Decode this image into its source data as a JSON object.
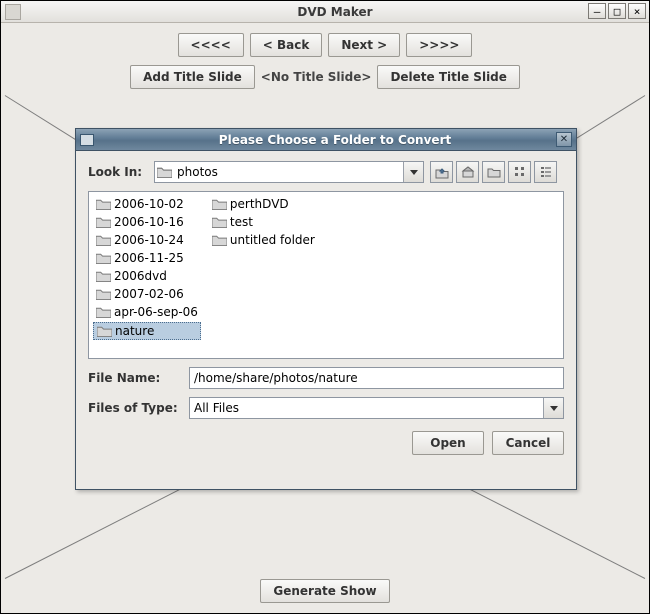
{
  "window": {
    "title": "DVD Maker"
  },
  "nav": {
    "first": "<<<<",
    "back": "< Back",
    "next": "Next >",
    "last": ">>>>"
  },
  "title_slide": {
    "add": "Add Title Slide",
    "none": "<No Title Slide>",
    "delete": "Delete Title Slide"
  },
  "generate": "Generate Show",
  "dialog": {
    "title": "Please Choose a Folder to Convert",
    "look_in_label": "Look In:",
    "look_in_value": "photos",
    "file_name_label": "File Name:",
    "file_name_value": "/home/share/photos/nature",
    "files_of_type_label": "Files of Type:",
    "files_of_type_value": "All Files",
    "open": "Open",
    "cancel": "Cancel",
    "folders_col1": [
      "2006-10-02",
      "2006-10-16",
      "2006-10-24",
      "2006-11-25",
      "2006dvd",
      "2007-02-06",
      "apr-06-sep-06",
      "nature"
    ],
    "folders_col2": [
      "perthDVD",
      "test",
      "untitled folder"
    ],
    "selected": "nature"
  },
  "icons": {
    "home": "home-icon",
    "up": "up-one-level-icon",
    "new_folder": "new-folder-icon",
    "list_view": "list-view-icon",
    "details_view": "details-view-icon"
  }
}
